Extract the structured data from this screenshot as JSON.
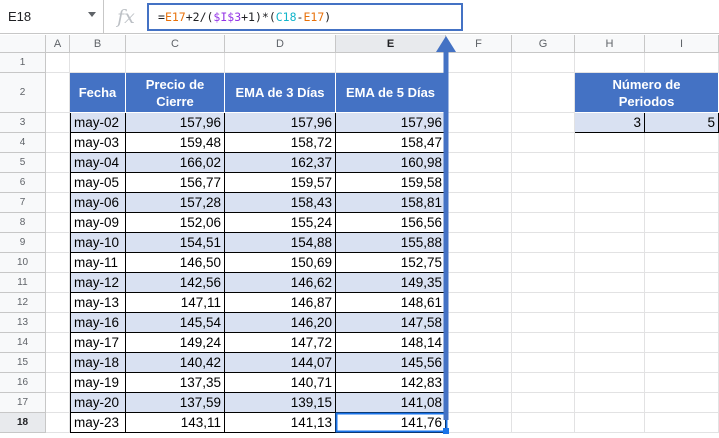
{
  "formula_bar": {
    "name_box": "E18",
    "fx_label": "fx",
    "formula_tokens": [
      {
        "t": "=",
        "c": "#202124"
      },
      {
        "t": "E17",
        "c": "#e8710a"
      },
      {
        "t": "+2/(",
        "c": "#202124"
      },
      {
        "t": "$I$3",
        "c": "#9334e6"
      },
      {
        "t": "+1)*(",
        "c": "#202124"
      },
      {
        "t": "C18",
        "c": "#12b5cb"
      },
      {
        "t": "-",
        "c": "#202124"
      },
      {
        "t": "E17",
        "c": "#e8710a"
      },
      {
        "t": ")",
        "c": "#202124"
      }
    ]
  },
  "grid": {
    "columns": [
      "A",
      "B",
      "C",
      "D",
      "E",
      "F",
      "G",
      "H",
      "I"
    ],
    "rows": [
      "1",
      "2",
      "3",
      "4",
      "5",
      "6",
      "7",
      "8",
      "9",
      "10",
      "11",
      "12",
      "13",
      "14",
      "15",
      "16",
      "17",
      "18"
    ],
    "selected_column": "E",
    "selected_row": "18",
    "active_cell": "E18"
  },
  "table": {
    "headers": [
      "Fecha",
      "Precio de Cierre",
      "EMA de 3 Días",
      "EMA de 5 Días"
    ],
    "rows": [
      [
        "may-02",
        "157,96",
        "157,96",
        "157,96"
      ],
      [
        "may-03",
        "159,48",
        "158,72",
        "158,47"
      ],
      [
        "may-04",
        "166,02",
        "162,37",
        "160,98"
      ],
      [
        "may-05",
        "156,77",
        "159,57",
        "159,58"
      ],
      [
        "may-06",
        "157,28",
        "158,43",
        "158,81"
      ],
      [
        "may-09",
        "152,06",
        "155,24",
        "156,56"
      ],
      [
        "may-10",
        "154,51",
        "154,88",
        "155,88"
      ],
      [
        "may-11",
        "146,50",
        "150,69",
        "152,75"
      ],
      [
        "may-12",
        "142,56",
        "146,62",
        "149,35"
      ],
      [
        "may-13",
        "147,11",
        "146,87",
        "148,61"
      ],
      [
        "may-16",
        "145,54",
        "146,20",
        "147,58"
      ],
      [
        "may-17",
        "149,24",
        "147,72",
        "148,14"
      ],
      [
        "may-18",
        "140,42",
        "144,07",
        "145,56"
      ],
      [
        "may-19",
        "137,35",
        "140,71",
        "142,83"
      ],
      [
        "may-20",
        "137,59",
        "139,15",
        "141,08"
      ],
      [
        "may-23",
        "143,11",
        "141,13",
        "141,76"
      ]
    ]
  },
  "periods": {
    "header": "Número de Periodos",
    "values": [
      "3",
      "5"
    ]
  },
  "colors": {
    "header_fill": "#4472c4",
    "band_fill": "#d9e1f2",
    "arrow": "#4472c4",
    "selection": "#1a73e8"
  }
}
